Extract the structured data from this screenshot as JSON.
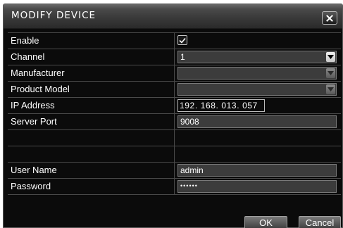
{
  "dialog": {
    "title": "MODIFY DEVICE"
  },
  "fields": {
    "enable": {
      "label": "Enable",
      "checked": true
    },
    "channel": {
      "label": "Channel",
      "value": "1"
    },
    "manufacturer": {
      "label": "Manufacturer",
      "value": ""
    },
    "product_model": {
      "label": "Product Model",
      "value": ""
    },
    "ip_address": {
      "label": "IP Address",
      "value": "192. 168. 013. 057"
    },
    "server_port": {
      "label": "Server Port",
      "value": "9008"
    },
    "user_name": {
      "label": "User Name",
      "value": "admin"
    },
    "password": {
      "label": "Password",
      "value": "••••••"
    }
  },
  "buttons": {
    "ok": "OK",
    "cancel": "Cancel"
  },
  "icons": {
    "close": "close-icon",
    "dropdown": "chevron-down-icon",
    "check": "checkmark-icon"
  }
}
